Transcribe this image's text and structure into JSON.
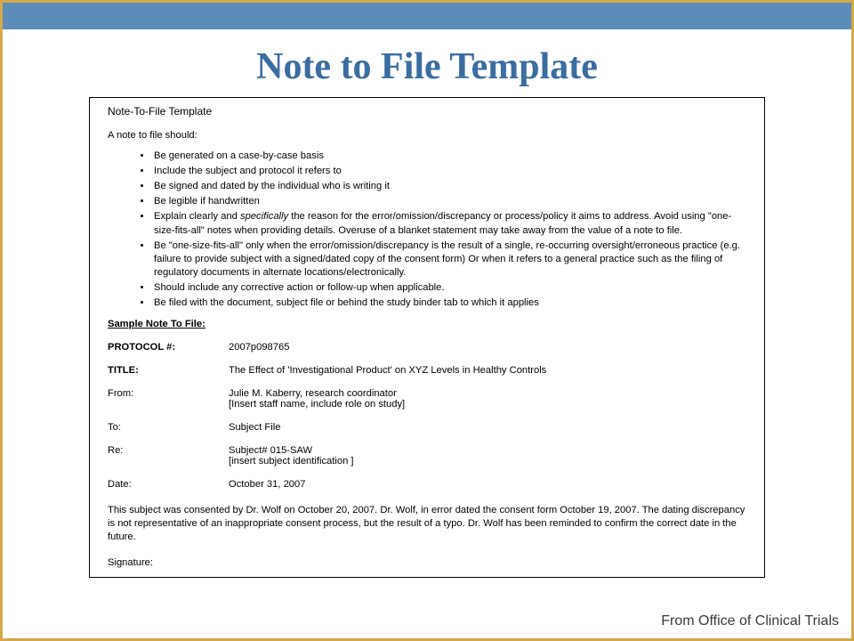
{
  "slide": {
    "title": "Note to File Template",
    "attribution": "From Office of Clinical Trials"
  },
  "doc": {
    "heading": "Note-To-File Template",
    "intro": "A note to file should:",
    "bullets": [
      "Be generated on a case-by-case basis",
      "Include the subject and protocol it refers to",
      "Be signed and dated by the individual who is writing it",
      "Be legible if handwritten",
      "",
      "Be \"one-size-fits-all\" only when the error/omission/discrepancy is the result of a single, re-occurring oversight/erroneous practice (e.g. failure to provide subject with a signed/dated copy of the consent form) Or when it refers to a general practice such as the filing of regulatory documents in alternate locations/electronically.",
      "Should include any corrective action or follow-up when applicable.",
      "Be filed with the document, subject file or behind the study binder tab to which it applies"
    ],
    "bullet5_pre": "Explain clearly and ",
    "bullet5_em": "specifically",
    "bullet5_post": " the reason for the error/omission/discrepancy or process/policy it aims to address. Avoid using \"one-size-fits-all\" notes when providing details. Overuse of a blanket statement may take away from the value of a note to file.",
    "sample_title": "Sample Note To File:",
    "fields": {
      "protocol_label": "PROTOCOL #:",
      "protocol_value": "2007p098765",
      "title_label": "TITLE:",
      "title_value": "The Effect of 'Investigational Product' on XYZ Levels in Healthy Controls",
      "from_label": "From:",
      "from_value": "Julie M. Kaberry, research coordinator",
      "from_hint": "[Insert staff name, include role on study]",
      "to_label": "To:",
      "to_value": "Subject File",
      "re_label": "Re:",
      "re_value": "Subject# 015-SAW",
      "re_hint": "[insert subject identification ]",
      "date_label": "Date:",
      "date_value": "October 31, 2007"
    },
    "body": "This subject was consented by Dr. Wolf on October 20, 2007. Dr. Wolf, in error dated the consent form October 19, 2007. The dating discrepancy is not representative of an inappropriate consent process, but the result of a typo. Dr. Wolf has been reminded to confirm the correct date in the future.",
    "signature_label": "Signature:"
  }
}
